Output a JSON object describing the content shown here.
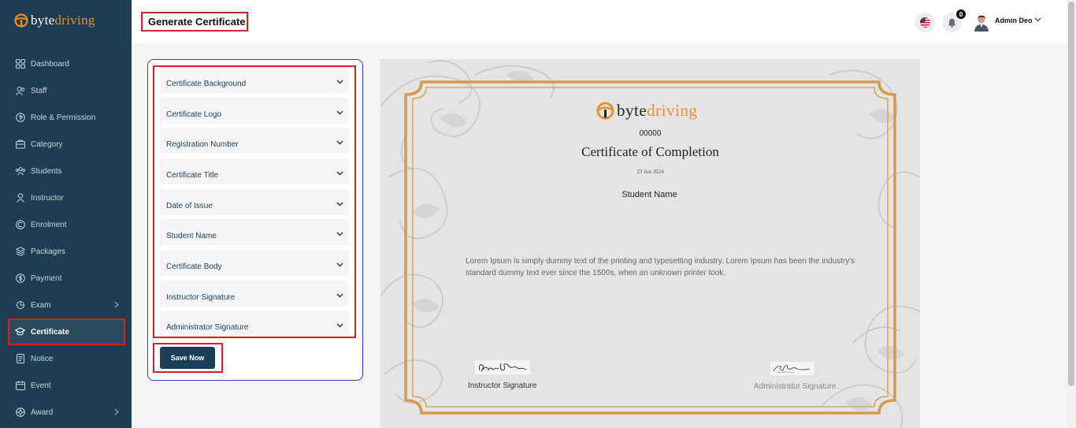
{
  "app": {
    "logo_part1": "byte",
    "logo_part2": "driving"
  },
  "sidebar": {
    "items": [
      {
        "label": "Dashboard",
        "icon": "dashboard-icon"
      },
      {
        "label": "Staff",
        "icon": "staff-icon"
      },
      {
        "label": "Role & Permission",
        "icon": "role-permission-icon"
      },
      {
        "label": "Category",
        "icon": "category-icon"
      },
      {
        "label": "Students",
        "icon": "students-icon"
      },
      {
        "label": "Instructor",
        "icon": "instructor-icon"
      },
      {
        "label": "Enrolment",
        "icon": "enrolment-icon"
      },
      {
        "label": "Packages",
        "icon": "packages-icon"
      },
      {
        "label": "Payment",
        "icon": "payment-icon"
      },
      {
        "label": "Exam",
        "icon": "exam-icon",
        "has_submenu": true
      },
      {
        "label": "Certificate",
        "icon": "certificate-icon",
        "active": true
      },
      {
        "label": "Notice",
        "icon": "notice-icon"
      },
      {
        "label": "Event",
        "icon": "event-icon"
      },
      {
        "label": "Award",
        "icon": "award-icon",
        "has_submenu": true
      }
    ]
  },
  "header": {
    "title": "Generate Certificate",
    "notification_count": "0",
    "user_name": "Admin Deo",
    "flag_icon": "us-flag-icon"
  },
  "settings": {
    "sections": [
      "Certificate Background",
      "Certificate Logo",
      "Registration Number",
      "Certificate Title",
      "Date of Issue",
      "Student Name",
      "Certificate Body",
      "Instructor Signature",
      "Administrator Signature"
    ],
    "save_label": "Save Now"
  },
  "certificate": {
    "logo_part1": "byte",
    "logo_part2": "driving",
    "registration_number": "00000",
    "title": "Certificate of Completion",
    "date": "23 Jun 2024",
    "student_name": "Student Name",
    "body": "Lorem Ipsum is simply dummy text of the printing and typesetting industry. Lorem Ipsum has been the industry's standard dummy text ever since the 1500s, when an unknown printer took.",
    "instructor_signature_label": "Instructor Signature",
    "administrator_signature_label": "Administrator Signature"
  },
  "colors": {
    "sidebar_bg": "#1e3d52",
    "accent_orange": "#e8902c",
    "frame_gold": "#d59a4d",
    "primary_button": "#1b3f58",
    "highlight_red": "#d61f26"
  }
}
